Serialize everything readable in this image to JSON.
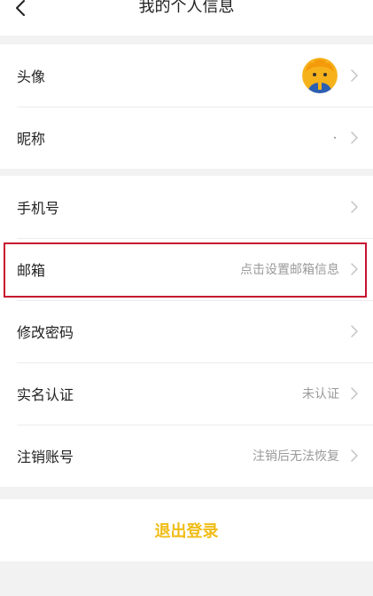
{
  "header": {
    "title": "我的个人信息",
    "back_icon": "chevron-left-icon"
  },
  "profile_group": {
    "avatar_label": "头像",
    "nickname_label": "昵称"
  },
  "account_group": {
    "phone_label": "手机号",
    "email_label": "邮箱",
    "email_value": "点击设置邮箱信息",
    "password_label": "修改密码",
    "realname_label": "实名认证",
    "realname_value": "未认证",
    "cancel_label": "注销账号",
    "cancel_value": "注销后无法恢复"
  },
  "logout": {
    "label": "退出登录",
    "color": "#f0bd17"
  },
  "highlight_color": "#c8102e"
}
